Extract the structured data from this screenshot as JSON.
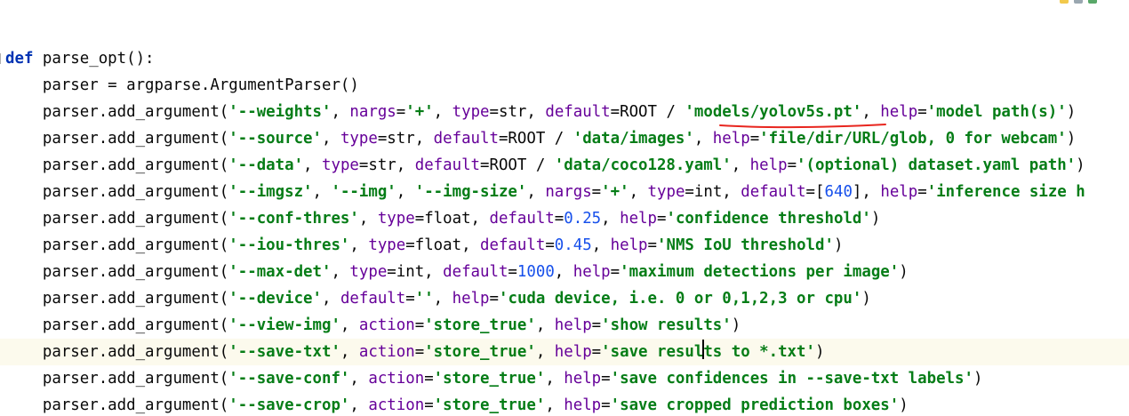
{
  "colors": {
    "keyword": "#0033b3",
    "string": "#067d17",
    "number": "#1750eb",
    "parameter": "#660099",
    "text": "#080808",
    "current_line": "#fcfaed",
    "annotation": "#e8261f"
  },
  "lines": [
    [
      "def",
      " parse_opt():"
    ],
    [
      "    parser = argparse.ArgumentParser()"
    ],
    [
      "    parser.add_argument(",
      "'--weights'",
      ", ",
      "nargs",
      "=",
      "'+'",
      ", ",
      "type",
      "=str, ",
      "default",
      "=ROOT / ",
      "'models/yolov5s.pt'",
      ", ",
      "help",
      "=",
      "'model path(s)'",
      ")"
    ],
    [
      "    parser.add_argument(",
      "'--source'",
      ", ",
      "type",
      "=str, ",
      "default",
      "=ROOT / ",
      "'data/images'",
      ", ",
      "help",
      "=",
      "'file/dir/URL/glob, 0 for webcam'",
      ")"
    ],
    [
      "    parser.add_argument(",
      "'--data'",
      ", ",
      "type",
      "=str, ",
      "default",
      "=ROOT / ",
      "'data/coco128.yaml'",
      ", ",
      "help",
      "=",
      "'(optional) dataset.yaml path'",
      ")"
    ],
    [
      "    parser.add_argument(",
      "'--imgsz'",
      ", ",
      "'--img'",
      ", ",
      "'--img-size'",
      ", ",
      "nargs",
      "=",
      "'+'",
      ", ",
      "type",
      "=int, ",
      "default",
      "=[",
      "640",
      "], ",
      "help",
      "=",
      "'inference size h"
    ],
    [
      "    parser.add_argument(",
      "'--conf-thres'",
      ", ",
      "type",
      "=float, ",
      "default",
      "=",
      "0.25",
      ", ",
      "help",
      "=",
      "'confidence threshold'",
      ")"
    ],
    [
      "    parser.add_argument(",
      "'--iou-thres'",
      ", ",
      "type",
      "=float, ",
      "default",
      "=",
      "0.45",
      ", ",
      "help",
      "=",
      "'NMS IoU threshold'",
      ")"
    ],
    [
      "    parser.add_argument(",
      "'--max-det'",
      ", ",
      "type",
      "=int, ",
      "default",
      "=",
      "1000",
      ", ",
      "help",
      "=",
      "'maximum detections per image'",
      ")"
    ],
    [
      "    parser.add_argument(",
      "'--device'",
      ", ",
      "default",
      "=",
      "''",
      ", ",
      "help",
      "=",
      "'cuda device, i.e. 0 or 0,1,2,3 or cpu'",
      ")"
    ],
    [
      "    parser.add_argument(",
      "'--view-img'",
      ", ",
      "action",
      "=",
      "'store_true'",
      ", ",
      "help",
      "=",
      "'show results'",
      ")"
    ],
    [
      "    parser.add_argument(",
      "'--save-txt'",
      ", ",
      "action",
      "=",
      "'store_true'",
      ", ",
      "help",
      "=",
      "'save results to *.txt'",
      ")"
    ],
    [
      "    parser.add_argument(",
      "'--save-conf'",
      ", ",
      "action",
      "=",
      "'store_true'",
      ", ",
      "help",
      "=",
      "'save confidences in --save-txt labels'",
      ")"
    ],
    [
      "    parser.add_argument(",
      "'--save-crop'",
      ", ",
      "action",
      "=",
      "'store_true'",
      ", ",
      "help",
      "=",
      "'save cropped prediction boxes'",
      ")"
    ]
  ],
  "token_styles": [
    [
      "kw",
      "plain"
    ],
    [
      "plain"
    ],
    [
      "plain",
      "str",
      "plain",
      "param",
      "plain",
      "str",
      "plain",
      "param",
      "plain",
      "param",
      "plain",
      "str",
      "plain",
      "param",
      "plain",
      "str",
      "plain"
    ],
    [
      "plain",
      "str",
      "plain",
      "param",
      "plain",
      "param",
      "plain",
      "str",
      "plain",
      "param",
      "plain",
      "str",
      "plain"
    ],
    [
      "plain",
      "str",
      "plain",
      "param",
      "plain",
      "param",
      "plain",
      "str",
      "plain",
      "param",
      "plain",
      "str",
      "plain"
    ],
    [
      "plain",
      "str",
      "plain",
      "str",
      "plain",
      "str",
      "plain",
      "param",
      "plain",
      "str",
      "plain",
      "param",
      "plain",
      "param",
      "plain",
      "num",
      "plain",
      "param",
      "plain",
      "str"
    ],
    [
      "plain",
      "str",
      "plain",
      "param",
      "plain",
      "param",
      "plain",
      "num",
      "plain",
      "param",
      "plain",
      "str",
      "plain"
    ],
    [
      "plain",
      "str",
      "plain",
      "param",
      "plain",
      "param",
      "plain",
      "num",
      "plain",
      "param",
      "plain",
      "str",
      "plain"
    ],
    [
      "plain",
      "str",
      "plain",
      "param",
      "plain",
      "param",
      "plain",
      "num",
      "plain",
      "param",
      "plain",
      "str",
      "plain"
    ],
    [
      "plain",
      "str",
      "plain",
      "param",
      "plain",
      "str",
      "plain",
      "param",
      "plain",
      "str",
      "plain"
    ],
    [
      "plain",
      "str",
      "plain",
      "param",
      "plain",
      "str",
      "plain",
      "param",
      "plain",
      "str",
      "plain"
    ],
    [
      "plain",
      "str",
      "plain",
      "param",
      "plain",
      "str",
      "plain",
      "param",
      "plain",
      "str",
      "plain"
    ],
    [
      "plain",
      "str",
      "plain",
      "param",
      "plain",
      "str",
      "plain",
      "param",
      "plain",
      "str",
      "plain"
    ],
    [
      "plain",
      "str",
      "plain",
      "param",
      "plain",
      "str",
      "plain",
      "param",
      "plain",
      "str",
      "plain"
    ]
  ],
  "current_line_index": 11
}
